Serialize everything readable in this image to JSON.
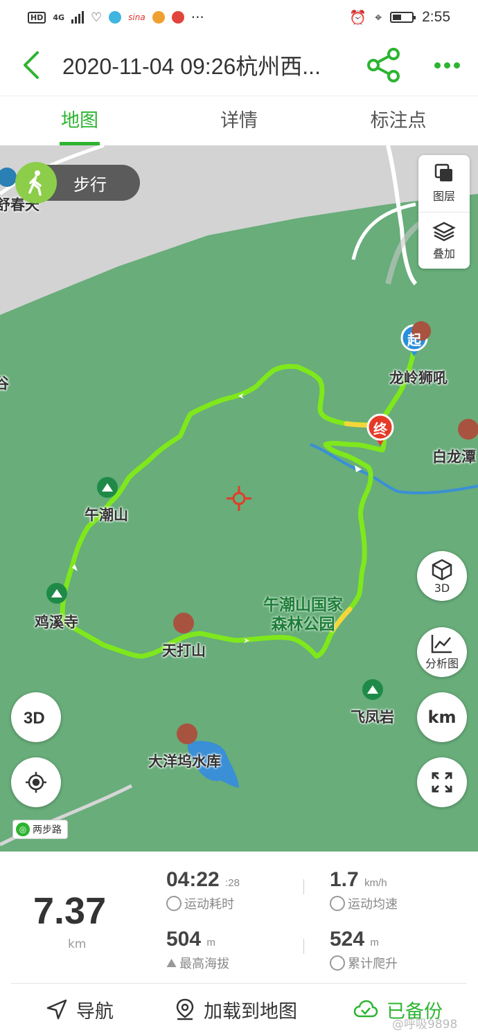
{
  "status_bar": {
    "network": "4G",
    "network_hd": "HD",
    "time": "2:55"
  },
  "header": {
    "title": "2020-11-04 09:26杭州西...",
    "back_icon": "chevron-left-icon",
    "share_icon": "share-icon",
    "more_icon": "more-icon",
    "accent": "#2db431"
  },
  "tabs": [
    {
      "label": "地图",
      "active": true
    },
    {
      "label": "详情",
      "active": false
    },
    {
      "label": "标注点",
      "active": false
    }
  ],
  "map": {
    "mode_label": "步行",
    "layers_label": "图层",
    "overlay_label": "叠加",
    "btn_3d_label": "3D",
    "btn_analysis_label": "分析图",
    "btn_km_label": "km",
    "start_marker": "起",
    "end_marker": "终",
    "labels": {
      "top_left": "舒春天",
      "left_edge": "谷",
      "longling": "龙岭狮吼",
      "bailong": "白龙潭",
      "wuchao": "午潮山",
      "jixi": "鸡溪寺",
      "tianda": "天打山",
      "park_line1": "午潮山国家",
      "park_line2": "森林公园",
      "feifeng": "飞凤岩",
      "dayangwu": "大洋坞水库"
    },
    "attribution": "两步路",
    "colors": {
      "forest": "#68ad7a",
      "urban": "#d3d3d3",
      "water": "#3a8fd6",
      "track": "#7fe81c",
      "start": "#2a8fdb",
      "end": "#e53a27"
    }
  },
  "stats": {
    "distance_value": "7.37",
    "distance_unit": "km",
    "duration_value": "04:22",
    "duration_seconds": ":28",
    "duration_label": "运动耗时",
    "avg_speed_value": "1.7",
    "avg_speed_unit": "km/h",
    "avg_speed_label": "运动均速",
    "max_alt_value": "504",
    "max_alt_unit": "m",
    "max_alt_label": "最高海拔",
    "climb_value": "524",
    "climb_unit": "m",
    "climb_label": "累计爬升"
  },
  "actions": {
    "navigate_label": "导航",
    "load_label": "加载到地图",
    "backup_label": "已备份"
  },
  "watermark": "@呼吸9898"
}
